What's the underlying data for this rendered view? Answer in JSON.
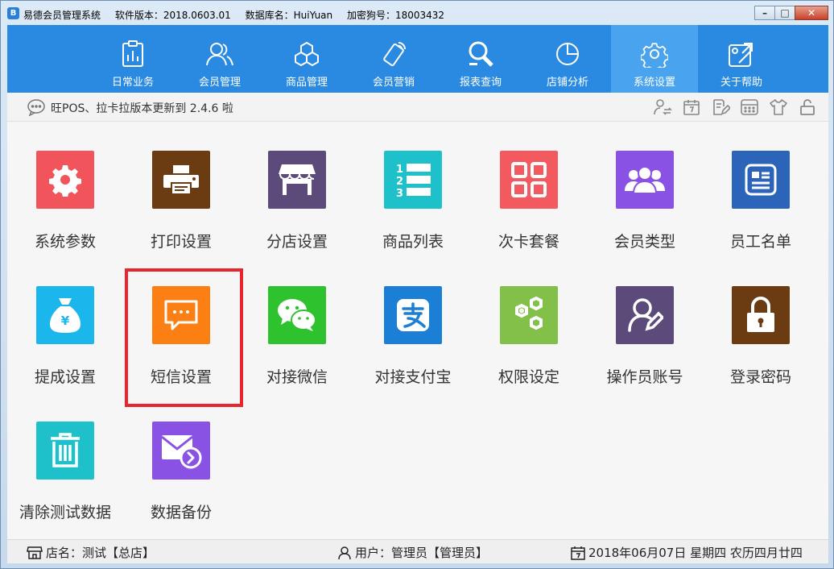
{
  "titlebar": {
    "app_name": "易德会员管理系统",
    "version": "软件版本：2018.0603.01",
    "database": "数据库名：HuiYuan",
    "dongle": "加密狗号：18003432",
    "logo_text": "B",
    "buttons": {
      "minimize": "–",
      "maximize": "□",
      "close": "✕"
    }
  },
  "nav": {
    "items": [
      {
        "label": "日常业务",
        "icon": "clipboard-chart-icon"
      },
      {
        "label": "会员管理",
        "icon": "members-icon"
      },
      {
        "label": "商品管理",
        "icon": "cubes-icon"
      },
      {
        "label": "会员营销",
        "icon": "phone-marketing-icon"
      },
      {
        "label": "报表查询",
        "icon": "search-report-icon"
      },
      {
        "label": "店铺分析",
        "icon": "pie-chart-icon"
      },
      {
        "label": "系统设置",
        "icon": "gear-icon",
        "active": true
      },
      {
        "label": "关于帮助",
        "icon": "help-icon"
      }
    ]
  },
  "infobar": {
    "message": "旺POS、拉卡拉版本更新到 2.4.6 啦",
    "tools": [
      "user-switch-icon",
      "calendar-icon",
      "notes-edit-icon",
      "calculator-icon",
      "tshirt-icon",
      "lock-icon"
    ]
  },
  "tiles": [
    {
      "label": "系统参数",
      "icon": "gear-icon",
      "color": "#f1545a"
    },
    {
      "label": "打印设置",
      "icon": "printer-icon",
      "color": "#6b3c12"
    },
    {
      "label": "分店设置",
      "icon": "store-icon",
      "color": "#5b4a7a"
    },
    {
      "label": "商品列表",
      "icon": "numbered-list-icon",
      "color": "#1ec1c9"
    },
    {
      "label": "次卡套餐",
      "icon": "grid-icon",
      "color": "#f35a60"
    },
    {
      "label": "会员类型",
      "icon": "group-icon",
      "color": "#8a52e4"
    },
    {
      "label": "员工名单",
      "icon": "id-card-icon",
      "color": "#2b64b8"
    },
    {
      "label": "提成设置",
      "icon": "money-bag-icon",
      "color": "#1bb6ec"
    },
    {
      "label": "短信设置",
      "icon": "sms-icon",
      "color": "#fb7f12"
    },
    {
      "label": "对接微信",
      "icon": "wechat-icon",
      "color": "#2fc22f"
    },
    {
      "label": "对接支付宝",
      "icon": "alipay-icon",
      "color": "#1a7fd5"
    },
    {
      "label": "权限设定",
      "icon": "cogs-icon",
      "color": "#83c04a"
    },
    {
      "label": "操作员账号",
      "icon": "user-edit-icon",
      "color": "#5b4a7a"
    },
    {
      "label": "登录密码",
      "icon": "padlock-icon",
      "color": "#6b3c12"
    },
    {
      "label": "清除测试数据",
      "icon": "trash-icon",
      "color": "#1ec1c9"
    },
    {
      "label": "数据备份",
      "icon": "mail-backup-icon",
      "color": "#8a52e4"
    }
  ],
  "statusbar": {
    "store": "店名：测试【总店】",
    "user": "用户：管理员【管理员】",
    "date": "2018年06月07日 星期四 农历四月廿四"
  }
}
